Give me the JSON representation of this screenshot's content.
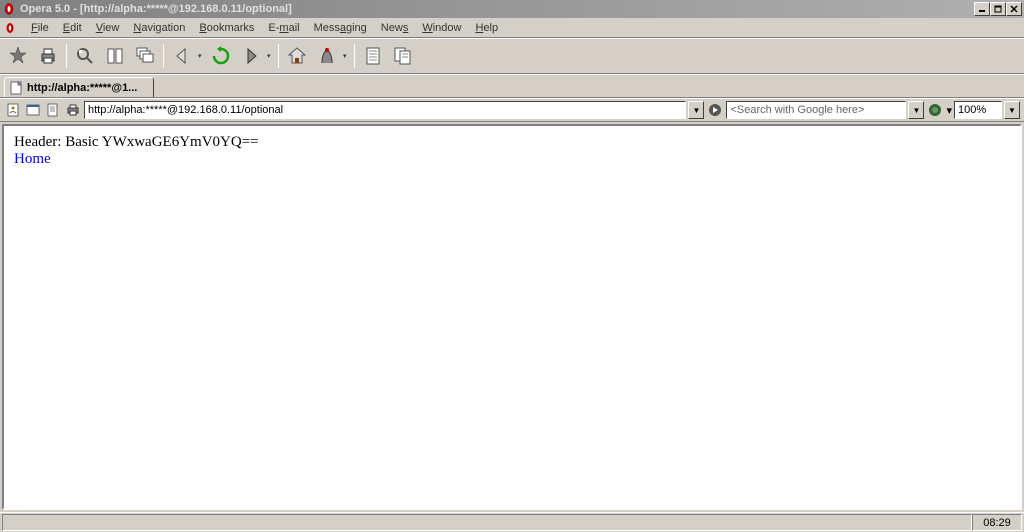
{
  "window": {
    "title": "Opera 5.0 - [http://alpha:*****@192.168.0.11/optional]"
  },
  "menu": {
    "file": "File",
    "edit": "Edit",
    "view": "View",
    "navigation": "Navigation",
    "bookmarks": "Bookmarks",
    "email": "E-mail",
    "messaging": "Messaging",
    "news": "News",
    "window": "Window",
    "help": "Help"
  },
  "tab": {
    "label": "http://alpha:*****@1..."
  },
  "address": {
    "url": "http://alpha:*****@192.168.0.11/optional"
  },
  "search": {
    "placeholder": "<Search with Google here>"
  },
  "zoom": {
    "value": "100%"
  },
  "page": {
    "header_line": "Header: Basic YWxwaGE6YmV0YQ==",
    "home_link": "Home"
  },
  "status": {
    "time": "08:29"
  }
}
